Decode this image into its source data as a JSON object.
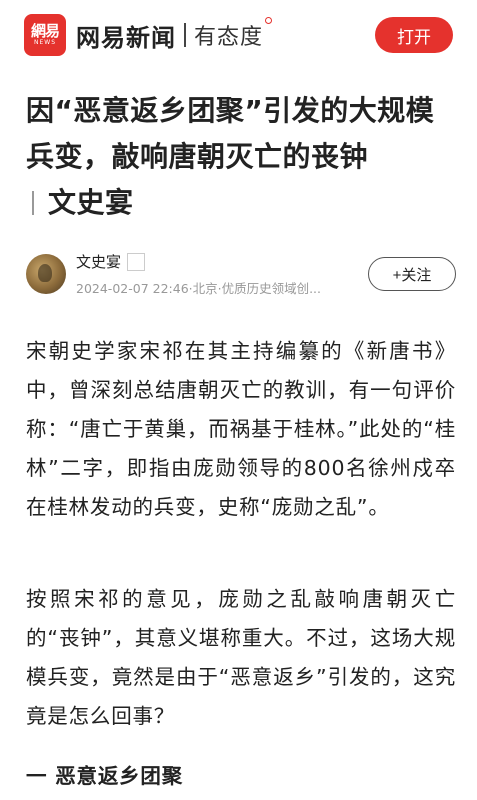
{
  "header": {
    "logo_cn": "網易",
    "logo_en": "NEWS",
    "brand": "网易新闻",
    "slogan": "有态度",
    "open_button": "打开"
  },
  "article": {
    "title": "因“恶意返乡团聚”引发的大规模兵变，敲响唐朝灭亡的丧钟",
    "column": "文史宴",
    "author": {
      "name": "文史宴",
      "meta": "2024-02-07 22:46·北京·优质历史领域创...",
      "follow_label": "+关注"
    },
    "paragraphs": [
      "宋朝史学家宋祁在其主持编纂的《新唐书》中，曾深刻总结唐朝灭亡的教训，有一句评价称：“唐亡于黄巢，而祸基于桂林。”此处的“桂林”二字，即指由庞勋领导的800名徐州戍卒在桂林发动的兵变，史称“庞勋之乱”。",
      "按照宋祁的意见，庞勋之乱敲响唐朝灭亡的“丧钟”，其意义堪称重大。不过，这场大规模兵变，竟然是由于“恶意返乡”引发的，这究竟是怎么回事？"
    ],
    "section_heading": "一 恶意返乡团聚"
  }
}
